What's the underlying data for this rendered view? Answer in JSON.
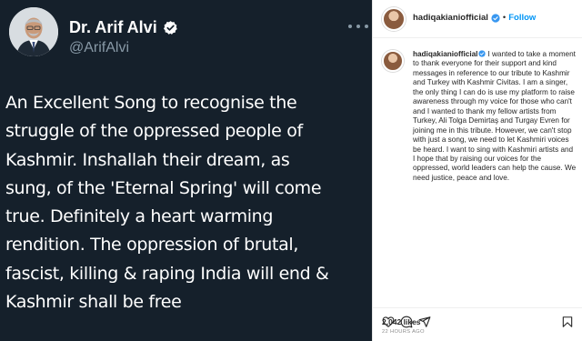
{
  "tweet": {
    "display_name": "Dr. Arif Alvi",
    "handle": "@ArifAlvi",
    "text": "An Excellent Song to recognise the\nstruggle of the oppressed people of\nKashmir. Inshallah their dream, as\nsung, of the 'Eternal Spring' will come\ntrue. Definitely a heart warming\nrendition. The oppression of brutal,\nfascist, killing & raping India will end &\nKashmir shall be free",
    "colors": {
      "background": "#15202b",
      "text": "#ffffff",
      "muted": "#8899a6",
      "verified": "#1da1f2"
    }
  },
  "instagram": {
    "username": "hadiqakianiofficial",
    "separator": "•",
    "follow_label": "Follow",
    "caption_username": "hadiqakianiofficial",
    "caption_text": "I wanted to take a moment to thank everyone for their support and kind messages in reference to our tribute to Kashmir and Turkey with Kashmir Civitas. I am a singer, the only thing I can do is use my platform to raise awareness through my voice for those who can't and I wanted to thank my fellow artists from Turkey, Ali Tolga Demirtaş and Turgay Evren for joining me in this tribute. However, we can't stop with just a song, we need to let Kashmiri voices be heard. I want to sing with Kashmiri artists and I hope that by raising our voices for the oppressed, world leaders can help the cause. We need justice, peace and love.",
    "likes": "2,042 likes",
    "timestamp": "22 HOURS AGO",
    "icons": [
      "more-icon",
      "heart-icon",
      "comment-icon",
      "share-icon",
      "bookmark-icon",
      "verified-icon"
    ],
    "colors": {
      "follow": "#0095f6",
      "text": "#262626",
      "muted": "#8e8e8e"
    }
  }
}
